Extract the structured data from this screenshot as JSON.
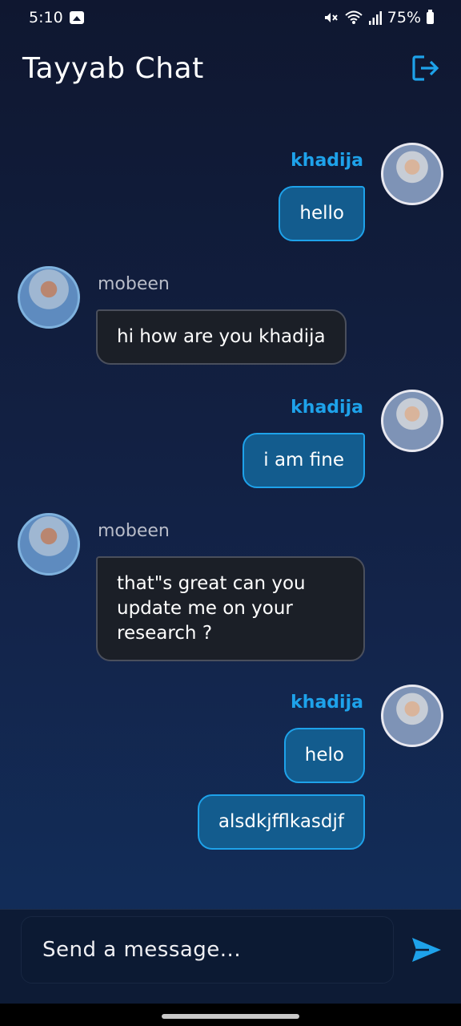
{
  "status_bar": {
    "time": "5:10",
    "battery": "75%",
    "icons": [
      "image-icon",
      "mute-icon",
      "wifi-icon",
      "signal-icon",
      "battery-icon"
    ]
  },
  "app_bar": {
    "title": "Tayyab Chat",
    "logout_icon": "logout-icon"
  },
  "messages": [
    {
      "sender": "khadija",
      "side": "right",
      "bubbles": [
        "hello"
      ]
    },
    {
      "sender": "mobeen",
      "side": "left",
      "bubbles": [
        "hi how are you khadija"
      ]
    },
    {
      "sender": "khadija",
      "side": "right",
      "bubbles": [
        "i am fine"
      ]
    },
    {
      "sender": "mobeen",
      "side": "left",
      "bubbles": [
        "that\"s great can you update me on your research ?"
      ]
    },
    {
      "sender": "khadija",
      "side": "right",
      "bubbles": [
        "helo",
        "alsdkjfflkasdjf"
      ]
    }
  ],
  "composer": {
    "placeholder": "Send a message...",
    "value": "",
    "send_icon": "send-icon"
  },
  "colors": {
    "accent": "#1ea2ea",
    "my_bubble": "#135c8e",
    "other_bubble": "#1b1f27",
    "background_top": "#0f1730",
    "background_bottom": "#12305e"
  }
}
